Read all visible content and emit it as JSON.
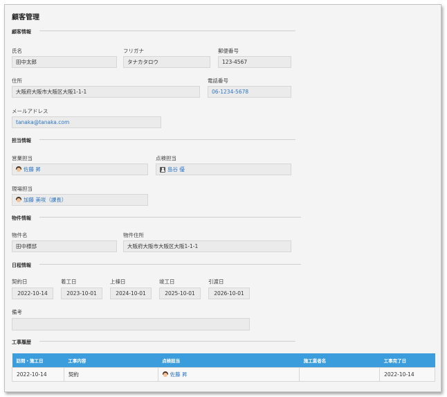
{
  "page_title": "顧客管理",
  "customer_info": {
    "section_title": "顧客情報",
    "name": {
      "label": "氏名",
      "value": "田中太郎"
    },
    "furigana": {
      "label": "フリガナ",
      "value": "タナカタロウ"
    },
    "postal_code": {
      "label": "郵便番号",
      "value": "123-4567"
    },
    "address": {
      "label": "住所",
      "value": "大阪府大阪市大阪区大阪1-1-1"
    },
    "phone": {
      "label": "電話番号",
      "value": "06-1234-5678"
    },
    "email": {
      "label": "メールアドレス",
      "value": "tanaka@tanaka.com"
    }
  },
  "staff_info": {
    "section_title": "担当情報",
    "sales": {
      "label": "営業担当",
      "value": "佐藤 昇",
      "icon": "avatar-face-icon"
    },
    "inspection": {
      "label": "点検担当",
      "value": "島谷 優",
      "icon": "user-icon"
    },
    "site": {
      "label": "現場担当",
      "value": "加藤 美咲（課長）",
      "icon": "avatar-face-icon"
    }
  },
  "property_info": {
    "section_title": "物件情報",
    "property_name": {
      "label": "物件名",
      "value": "田中様邸"
    },
    "property_address": {
      "label": "物件住所",
      "value": "大阪府大阪市大阪区大阪1-1-1"
    }
  },
  "schedule_info": {
    "section_title": "日程情報",
    "contract_date": {
      "label": "契約日",
      "value": "2022-10-14"
    },
    "start_date": {
      "label": "着工日",
      "value": "2023-10-01"
    },
    "framing_date": {
      "label": "上棟日",
      "value": "2024-10-01"
    },
    "completion_date": {
      "label": "竣工日",
      "value": "2025-10-01"
    },
    "handover_date": {
      "label": "引渡日",
      "value": "2026-10-01"
    },
    "notes": {
      "label": "備考",
      "value": ""
    }
  },
  "work_history": {
    "section_title": "工事履歴",
    "columns": [
      "訪問・施工日",
      "工事内容",
      "点検担当",
      "施工業者名",
      "工事完了日"
    ],
    "rows": [
      {
        "visit_date": "2022-10-14",
        "work": "契約",
        "inspector": "佐藤 昇",
        "contractor": "",
        "completed": "2022-10-14"
      }
    ]
  },
  "colors": {
    "accent": "#3c9ddd",
    "link": "#2a74c6",
    "field_bg": "#ebebeb",
    "panel_bg": "#f4f4f4"
  }
}
